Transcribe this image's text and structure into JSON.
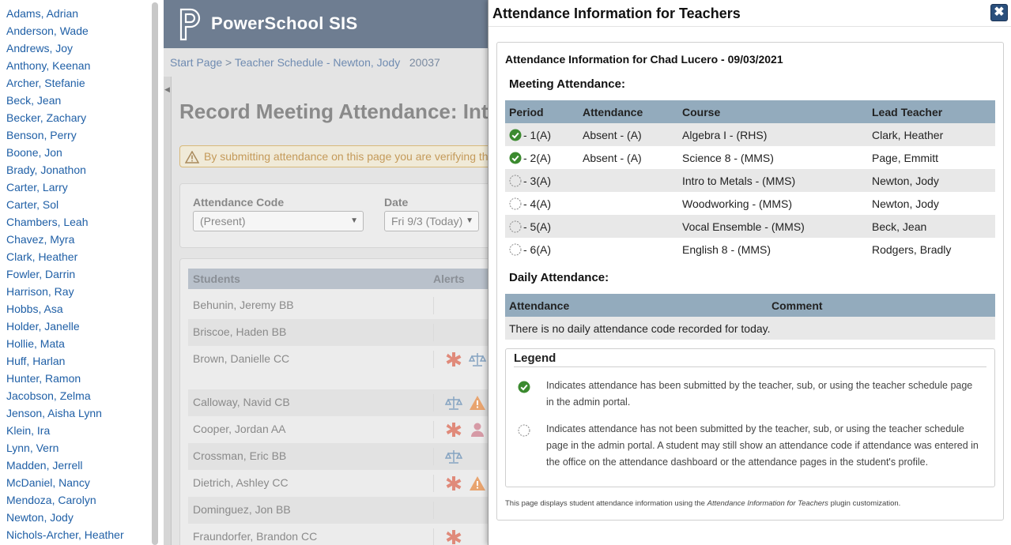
{
  "teachers": [
    "Adams, Adrian",
    "Anderson, Wade",
    "Andrews, Joy",
    "Anthony, Keenan",
    "Archer, Stefanie",
    "Beck, Jean",
    "Becker, Zachary",
    "Benson, Perry",
    "Boone, Jon",
    "Brady, Jonathon",
    "Carter, Larry",
    "Carter, Sol",
    "Chambers, Leah",
    "Chavez, Myra",
    "Clark, Heather",
    "Fowler, Darrin",
    "Harrison, Ray",
    "Hobbs, Asa",
    "Holder, Janelle",
    "Hollie, Mata",
    "Huff, Harlan",
    "Hunter, Ramon",
    "Jacobson, Zelma",
    "Jenson, Aisha Lynn",
    "Klein, Ira",
    "Lynn, Vern",
    "Madden, Jerrell",
    "McDaniel, Nancy",
    "Mendoza, Carolyn",
    "Newton, Jody",
    "Nichols-Archer, Heather"
  ],
  "app": {
    "title": "PowerSchool SIS",
    "breadcrumb": {
      "start": "Start Page",
      "sep": ">",
      "schedule": "Teacher Schedule - Newton, Jody",
      "id": "20037"
    },
    "page_title": "Record Meeting Attendance: Intr",
    "warning": "By submitting attendance on this page you are verifying th",
    "filters": {
      "code_label": "Attendance Code",
      "code_value": "(Present)",
      "date_label": "Date",
      "date_value": "Fri 9/3 (Today)"
    },
    "students_header": {
      "students": "Students",
      "alerts": "Alerts"
    },
    "students": [
      "Behunin, Jeremy BB",
      "Briscoe, Haden BB",
      "Brown, Danielle CC",
      "Calloway, Navid CB",
      "Cooper, Jordan AA",
      "Crossman, Eric BB",
      "Dietrich, Ashley CC",
      "Dominguez, Jon BB",
      "Fraundorfer, Brandon CC"
    ]
  },
  "dialog": {
    "title": "Attendance Information for Teachers",
    "close_label": "✖",
    "info_title": "Attendance Information for Chad Lucero - 09/03/2021",
    "meeting_heading": "Meeting Attendance:",
    "meeting_columns": {
      "period": "Period",
      "attendance": "Attendance",
      "course": "Course",
      "teacher": "Lead Teacher"
    },
    "meetings": [
      {
        "period": "- 1(A)",
        "attendance": "Absent - (A)",
        "course": "Algebra I - (RHS)",
        "teacher": "Clark, Heather",
        "submitted": true
      },
      {
        "period": "- 2(A)",
        "attendance": "Absent - (A)",
        "course": "Science 8 - (MMS)",
        "teacher": "Page, Emmitt",
        "submitted": true
      },
      {
        "period": "- 3(A)",
        "attendance": "",
        "course": "Intro to Metals - (MMS)",
        "teacher": "Newton, Jody",
        "submitted": false
      },
      {
        "period": "- 4(A)",
        "attendance": "",
        "course": "Woodworking - (MMS)",
        "teacher": "Newton, Jody",
        "submitted": false
      },
      {
        "period": "- 5(A)",
        "attendance": "",
        "course": "Vocal Ensemble - (MMS)",
        "teacher": "Beck, Jean",
        "submitted": false
      },
      {
        "period": "- 6(A)",
        "attendance": "",
        "course": "English 8 - (MMS)",
        "teacher": "Rodgers, Bradly",
        "submitted": false
      }
    ],
    "daily_heading": "Daily Attendance:",
    "daily_columns": {
      "attendance": "Attendance",
      "comment": "Comment"
    },
    "daily_message": "There is no daily attendance code recorded for today.",
    "legend": {
      "title": "Legend",
      "submitted": "Indicates attendance has been submitted by the teacher, sub, or using the teacher schedule page in the admin portal.",
      "not_submitted": "Indicates attendance has not been submitted by the teacher, sub, or using the teacher schedule page in the admin portal. A student may still show an attendance code if attendance was entered in the office on the attendance dashboard or the attendance pages in the student's profile."
    },
    "footnote": {
      "pre": "This page displays student attendance information using the",
      "plugin": "Attendance Information for Teachers",
      "post": "plugin customization."
    }
  },
  "colors": {
    "link": "#1f5fa6",
    "submitted": "#3b8a2f",
    "header_bar": "#93abbd",
    "close_button": "#2a4f7c"
  }
}
